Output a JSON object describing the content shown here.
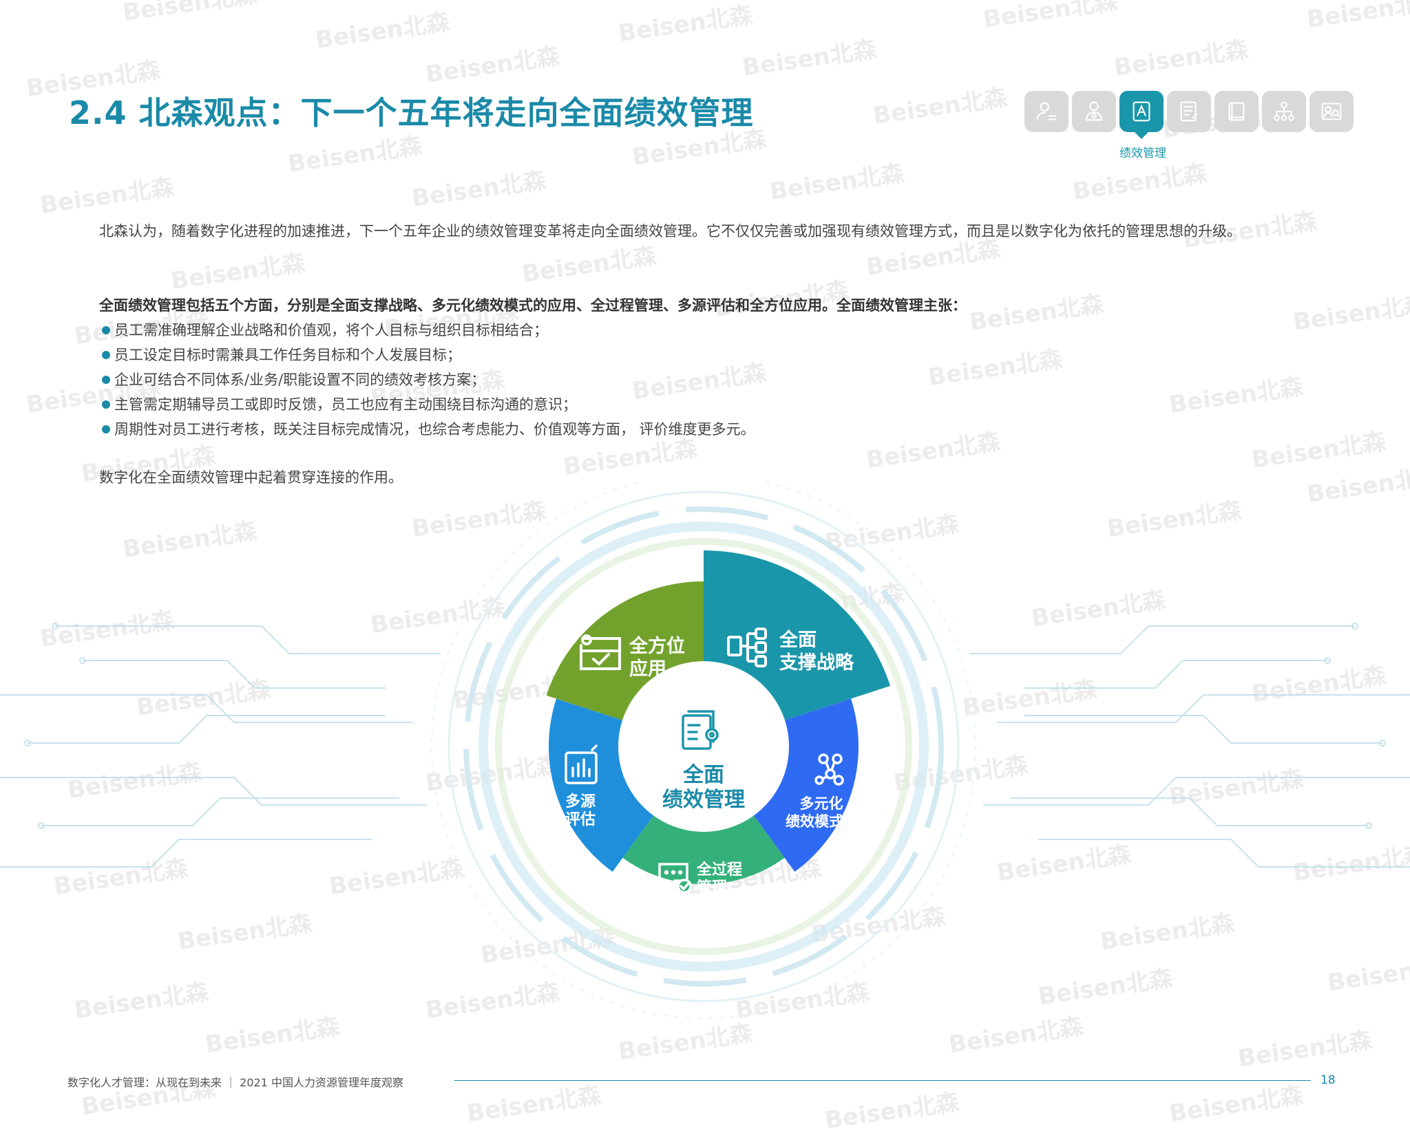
{
  "page": {
    "title": "2.4 北森观点：下一个五年将走向全面绩效管理",
    "watermark": "Beisen北森"
  },
  "nav": {
    "tabs": [
      {
        "icon": "person-list-icon",
        "active": false
      },
      {
        "icon": "person-icon",
        "active": false
      },
      {
        "icon": "performance-icon",
        "active": true
      },
      {
        "icon": "document-edit-icon",
        "active": false
      },
      {
        "icon": "book-icon",
        "active": false
      },
      {
        "icon": "org-chart-icon",
        "active": false
      },
      {
        "icon": "profile-search-icon",
        "active": false
      }
    ],
    "active_label": "绩效管理"
  },
  "body": {
    "intro": "北森认为，随着数字化进程的加速推进，下一个五年企业的绩效管理变革将走向全面绩效管理。它不仅仅完善或加强现有绩效管理方式，而且是以数字化为依托的管理思想的升级。",
    "aspects_heading": "全面绩效管理包括五个方面，分别是全面支撑战略、多元化绩效模式的应用、全过程管理、多源评估和全方位应用。全面绩效管理主张：",
    "bullets": [
      "员工需准确理解企业战略和价值观，将个人目标与组织目标相结合；",
      "员工设定目标时需兼具工作任务目标和个人发展目标；",
      "企业可结合不同体系/业务/职能设置不同的绩效考核方案；",
      "主管需定期辅导员工或即时反馈，员工也应有主动围绕目标沟通的意识；",
      "周期性对员工进行考核，既关注目标完成情况，也综合考虑能力、价值观等方面， 评价维度更多元。"
    ],
    "closing": "数字化在全面绩效管理中起着贯穿连接的作用。"
  },
  "diagram": {
    "center": {
      "line1": "全面",
      "line2": "绩效管理",
      "icon": "document-gear-icon"
    },
    "segments": [
      {
        "id": "strategy",
        "line1": "全面",
        "line2": "支撑战略",
        "icon": "hierarchy-icon",
        "color": "#1a96aa"
      },
      {
        "id": "model",
        "line1": "多元化",
        "line2": "绩效模式",
        "icon": "network-icon",
        "color": "#2f6bf2"
      },
      {
        "id": "process",
        "line1": "全过程",
        "line2": "管理",
        "icon": "chat-check-icon",
        "color": "#34b07a"
      },
      {
        "id": "evaluation",
        "line1": "多源",
        "line2": "评估",
        "icon": "bar-chart-icon",
        "color": "#1f8fdc"
      },
      {
        "id": "application",
        "line1": "全方位",
        "line2": "应用",
        "icon": "id-card-icon",
        "color": "#72a22c"
      }
    ]
  },
  "footer": {
    "report_title": "数字化人才管理：从现在到未来 ｜ 2021 中国人力资源管理年度观察",
    "page_number": "18"
  }
}
